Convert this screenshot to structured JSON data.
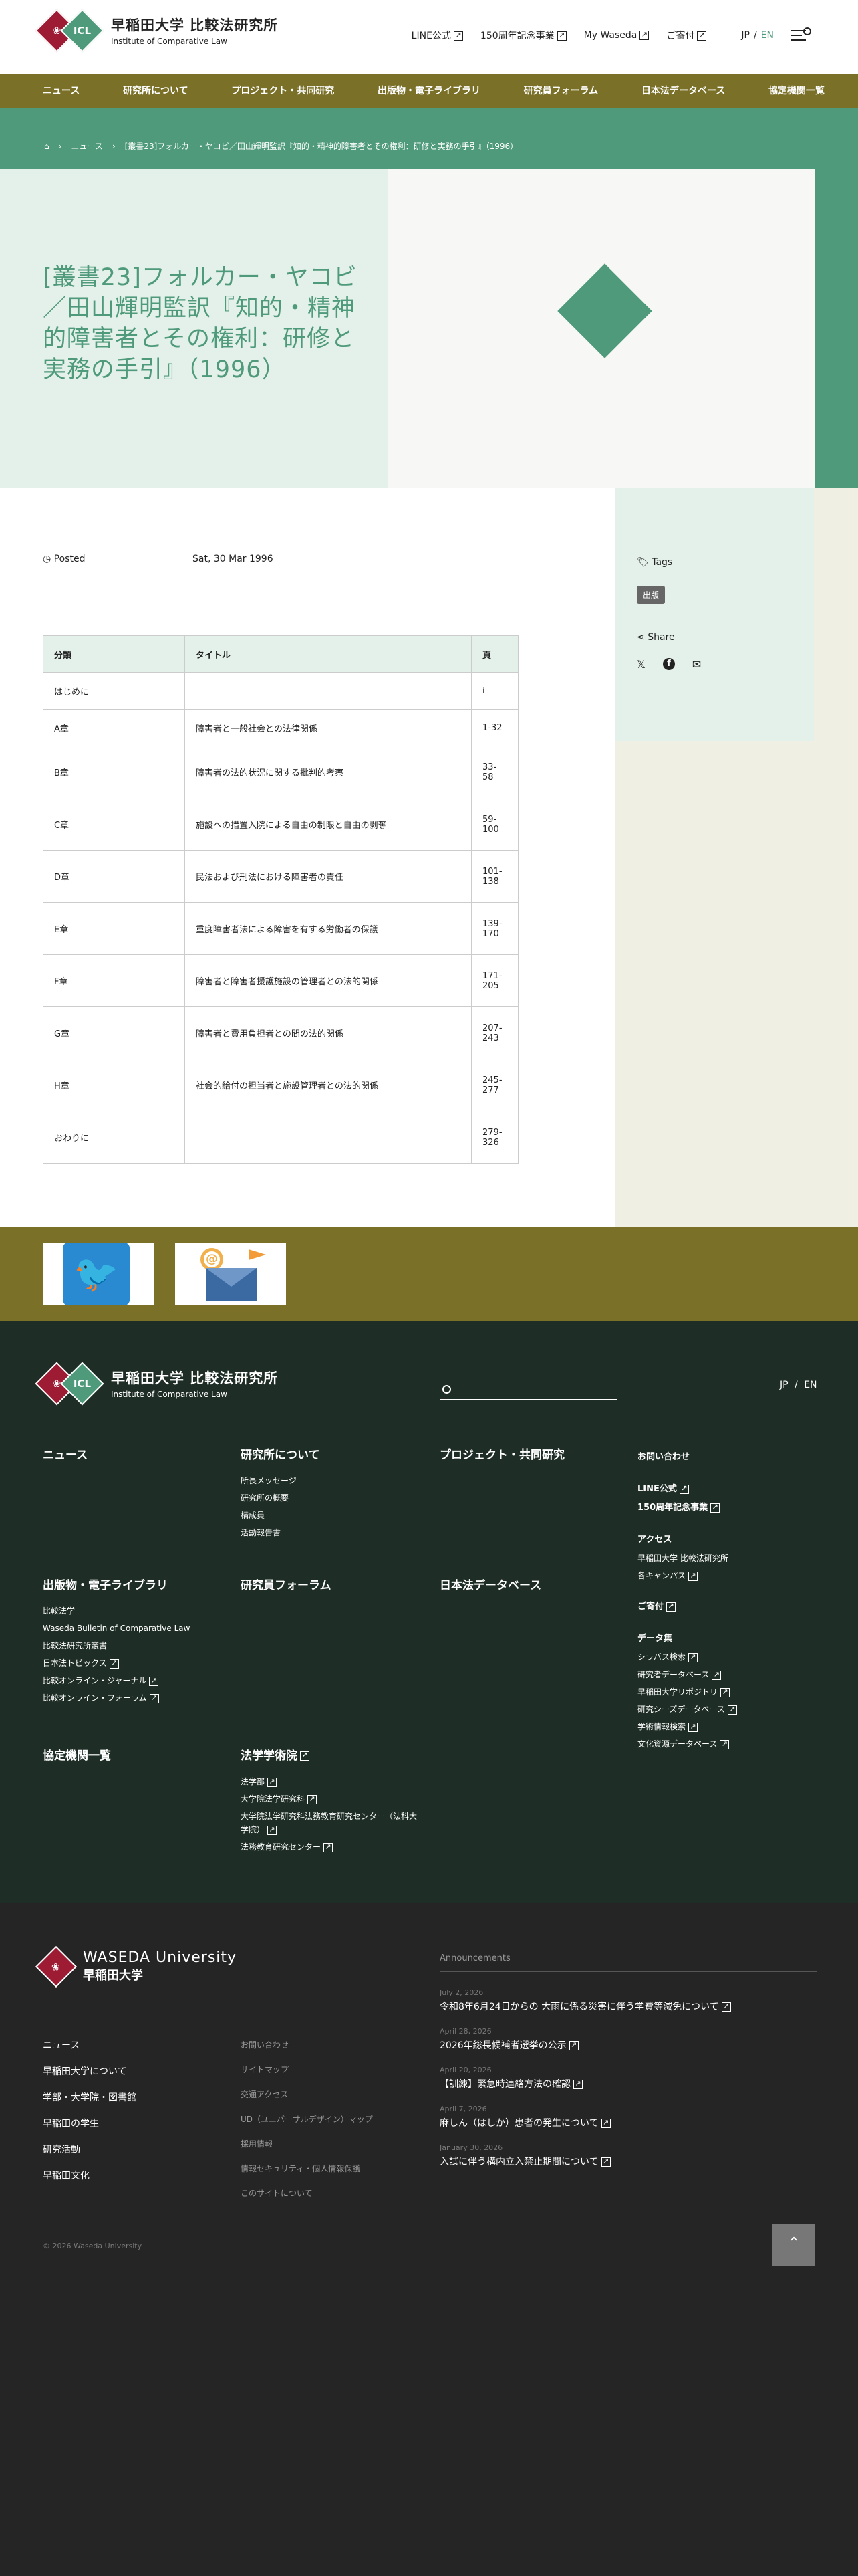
{
  "header": {
    "logo_ja": "早稲田大学 比較法研究所",
    "logo_en": "Institute of Comparative Law",
    "logo_badge": "ICL",
    "utils": [
      "LINE公式",
      "150周年記念事業",
      "My Waseda",
      "ご寄付"
    ],
    "lang_ja": "JP",
    "lang_sep": "/",
    "lang_en": "EN"
  },
  "nav": [
    "ニュース",
    "研究所について",
    "プロジェクト・共同研究",
    "出版物・電子ライブラリ",
    "研究員フォーラム",
    "日本法データベース",
    "協定機関一覧"
  ],
  "breadcrumb": [
    "ニュース",
    "[叢書23]フォルカー・ヤコビ／田山輝明監訳『知的・精神的障害者とその権利：研修と実務の手引』（1996）"
  ],
  "title": "[叢書23]フォルカー・ヤコビ／田山輝明監訳『知的・精神的障害者とその権利：研修と実務の手引』（1996）",
  "post": {
    "label": "Posted",
    "date": "Sat, 30 Mar 1996"
  },
  "sidebar": {
    "tags_label": "Tags",
    "tag": "出版",
    "share_label": "Share"
  },
  "table": {
    "headers": [
      "分類",
      "タイトル",
      "頁"
    ],
    "rows": [
      [
        "はじめに",
        "",
        "i"
      ],
      [
        "A章",
        "障害者と一般社会との法律関係",
        "1-32"
      ],
      [
        "B章",
        "障害者の法的状況に関する批判的考察",
        "33-58"
      ],
      [
        "C章",
        "施設への措置入院による自由の制限と自由の剥奪",
        "59-100"
      ],
      [
        "D章",
        "民法および刑法における障害者の責任",
        "101-138"
      ],
      [
        "E章",
        "重度障害者法による障害を有する労働者の保護",
        "139-170"
      ],
      [
        "F章",
        "障害者と障害者援護施設の管理者との法的関係",
        "171-205"
      ],
      [
        "G章",
        "障害者と費用負担者との間の法的関係",
        "207-243"
      ],
      [
        "H章",
        "社会的給付の担当者と施設管理者との法的関係",
        "245-277"
      ],
      [
        "おわりに",
        "",
        "279-326"
      ]
    ]
  },
  "footer1": {
    "col1a": {
      "title": "ニュース"
    },
    "col2a": {
      "title": "研究所について",
      "items": [
        "所長メッセージ",
        "研究所の概要",
        "構成員",
        "活動報告書"
      ]
    },
    "col3a": {
      "title": "プロジェクト・共同研究"
    },
    "col4": {
      "title": "お問い合わせ",
      "line": "LINE公式",
      "anniv": "150周年記念事業",
      "access": "アクセス",
      "access_items": [
        "早稲田大学 比較法研究所",
        "各キャンパス"
      ],
      "donate": "ご寄付",
      "data": "データ集",
      "data_items": [
        "シラバス検索",
        "研究者データベース",
        "早稲田大学リポジトリ",
        "研究シーズデータベース",
        "学術情報検索",
        "文化資源データベース"
      ]
    },
    "col1b": {
      "title": "出版物・電子ライブラリ",
      "items": [
        "比較法学",
        "Waseda Bulletin of Comparative Law",
        "比較法研究所叢書",
        "日本法トピックス",
        "比較オンライン・ジャーナル",
        "比較オンライン・フォーラム"
      ]
    },
    "col2b": {
      "title": "研究員フォーラム"
    },
    "col3b": {
      "title": "日本法データベース"
    },
    "col1c": {
      "title": "協定機関一覧"
    },
    "col2c": {
      "title": "法学学術院",
      "items": [
        "法学部",
        "大学院法学研究科",
        "大学院法学研究科法務教育研究センター（法科大学院）",
        "法務教育研究センター"
      ]
    }
  },
  "footer2": {
    "logo_en": "WASEDA University",
    "logo_ja": "早稲田大学",
    "links1": [
      "ニュース",
      "早稲田大学について",
      "学部・大学院・図書館",
      "早稲田の学生",
      "研究活動",
      "早稲田文化"
    ],
    "links2": [
      "お問い合わせ",
      "サイトマップ",
      "交通アクセス",
      "UD（ユニバーサルデザイン）マップ",
      "採用情報",
      "情報セキュリティ・個人情報保護",
      "このサイトについて"
    ],
    "ann_label": "Announcements",
    "announcements": [
      {
        "date": "July 2, 2026",
        "title": "令和8年6月24日からの 大雨に係る災害に伴う学費等減免について"
      },
      {
        "date": "April 28, 2026",
        "title": "2026年総長候補者選挙の公示"
      },
      {
        "date": "April 20, 2026",
        "title": "【訓練】緊急時連絡方法の確認"
      },
      {
        "date": "April 7, 2026",
        "title": "麻しん（はしか）患者の発生について"
      },
      {
        "date": "January 30, 2026",
        "title": "入試に伴う構内立入禁止期間について"
      }
    ],
    "copyright": "© 2026 Waseda University"
  }
}
